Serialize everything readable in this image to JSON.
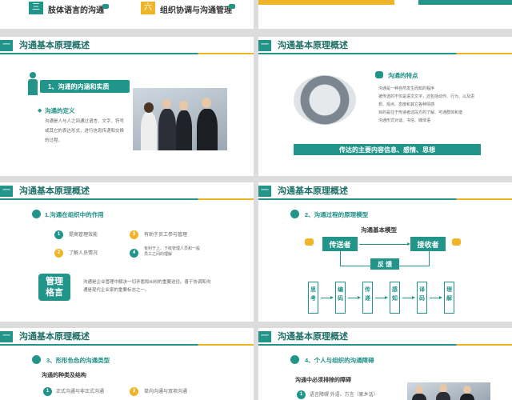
{
  "top_left": {
    "item_num": "三",
    "item_label": "肢体语言的沟通",
    "item2_num": "六",
    "item2_label": "组织协调与沟通管理"
  },
  "section_title": "沟通基本原理概述",
  "slide1": {
    "heading": "1、沟通的内涵和实质",
    "sub": "沟通的定义",
    "text": "沟通是人与人之间通过语言、文字、符号或其它的表达形式，进行信息传递和交换的过程。"
  },
  "slide2": {
    "heading": "沟通的特点",
    "text": "沟通是一种自然发生而知的程序\n被传送的不仅是语文文字，还包括动作、行为、以及思想、观点、态度和其它各种情感\n目的是往于传递者这段方的了解、可通群体和谐\n沟通形式对谈、书信、媒体语",
    "banner": "传达的主要内容信息、感情、思想"
  },
  "slide3": {
    "heading": "1.沟通在组织中的作用",
    "items": [
      {
        "num": "1",
        "text": "提高管理效能"
      },
      {
        "num": "2",
        "text": "了解人员情况"
      },
      {
        "num": "3",
        "text": "有助于员工参与管理"
      },
      {
        "num": "4",
        "text": "有利于上、下级管理人员和一般员工之间的理解"
      }
    ],
    "badge": "管理格言",
    "quote": "沟通是企业管理中解决一切矛盾和纠纷的重要途径。善于协调和沟通是现代企业家的重要标志之一。"
  },
  "slide4": {
    "heading": "2、沟通过程的原理模型",
    "model_title": "沟通基本模型",
    "sender": "传送者",
    "receiver": "接收者",
    "feedback": "反 馈",
    "steps": [
      "思考",
      "编码",
      "传递",
      "感知",
      "译码",
      "理解"
    ]
  },
  "slide5": {
    "heading": "3、形形色色的沟通类型",
    "sub": "沟通的种类及结构",
    "items": [
      {
        "num": "1",
        "text": "正式沟通与非正式沟通"
      },
      {
        "num": "3",
        "text": "单向沟通与双项沟通"
      }
    ]
  },
  "slide6": {
    "heading": "4、个人与组织的沟通障碍",
    "sub": "沟通中必须排除的障碍",
    "items": [
      {
        "num": "1",
        "text": "语言障碍 外语、方言（家乡话）"
      }
    ]
  }
}
